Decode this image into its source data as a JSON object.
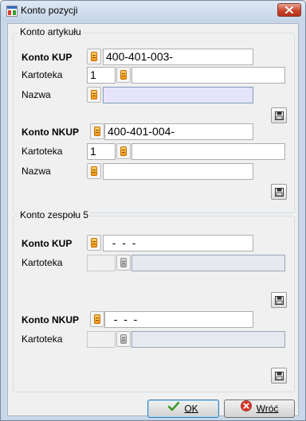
{
  "window": {
    "title": "Konto pozycji"
  },
  "group_article": {
    "title": "Konto artykułu",
    "kup": {
      "label": "Konto KUP",
      "value": "400-401-003-"
    },
    "kup_kartoteka": {
      "label": "Kartoteka",
      "value": "1",
      "name_value": ""
    },
    "kup_nazwa": {
      "label": "Nazwa",
      "value": ""
    },
    "nkup": {
      "label": "Konto NKUP",
      "value": "400-401-004-"
    },
    "nkup_kartoteka": {
      "label": "Kartoteka",
      "value": "1",
      "name_value": ""
    },
    "nkup_nazwa": {
      "label": "Nazwa",
      "value": ""
    }
  },
  "group_team": {
    "title": "Konto zespołu 5",
    "kup": {
      "label": "Konto KUP",
      "value": "  -  -  -"
    },
    "kup_kartoteka": {
      "label": "Kartoteka",
      "value": "",
      "name_value": ""
    },
    "nkup": {
      "label": "Konto NKUP",
      "value": "  -  -  -"
    },
    "nkup_kartoteka": {
      "label": "Kartoteka",
      "value": "",
      "name_value": ""
    }
  },
  "buttons": {
    "ok": "OK",
    "cancel": "Wróć"
  },
  "icons": {
    "window": "window-app-icon",
    "close": "close-icon",
    "lookup": "card-index-icon",
    "save": "floppy-disk-icon",
    "ok": "checkmark-icon",
    "cancel": "cancel-icon"
  },
  "colors": {
    "close_button": "#c9452b",
    "lookup_icon": "#f49a12",
    "ok_check": "#3a9a2a",
    "cancel_red": "#d9342a"
  }
}
